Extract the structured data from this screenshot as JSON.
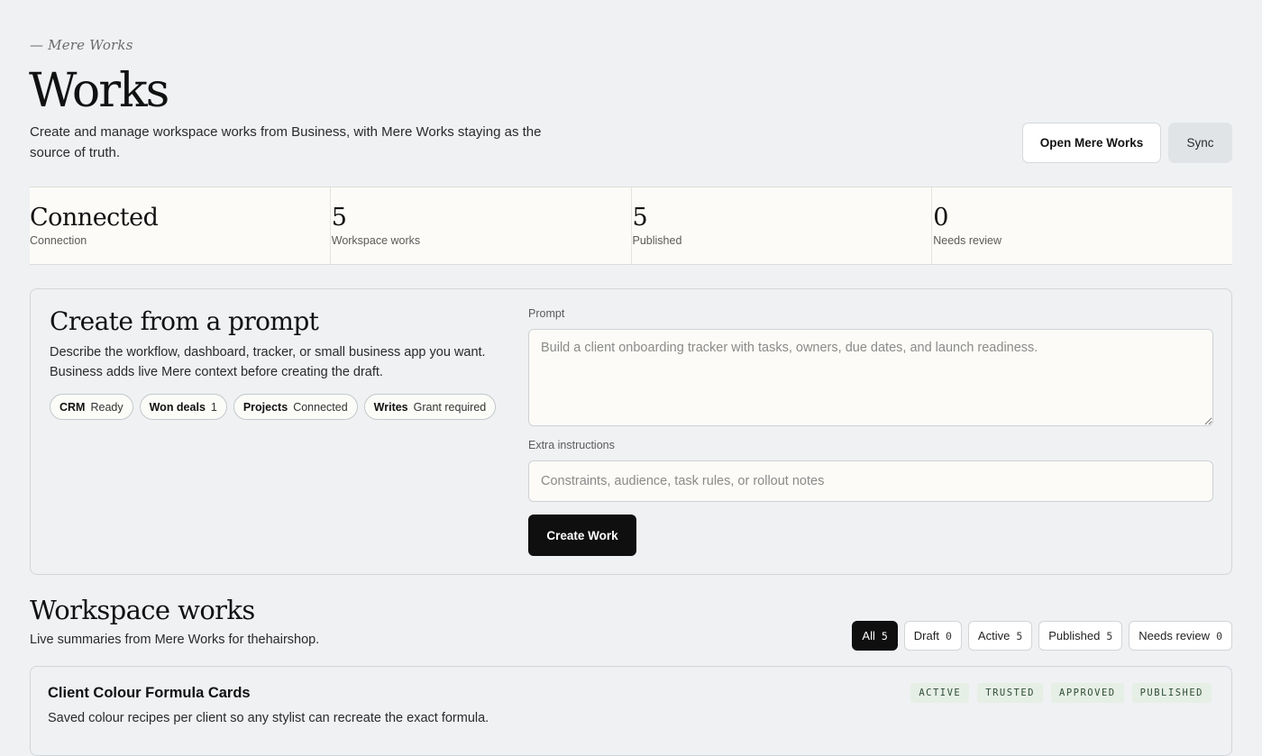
{
  "header": {
    "eyebrow": "— Mere Works",
    "title": "Works",
    "description": "Create and manage workspace works from Business, with Mere Works staying as the source of truth.",
    "open_button": "Open Mere Works",
    "sync_button": "Sync"
  },
  "stats": [
    {
      "value": "Connected",
      "label": "Connection"
    },
    {
      "value": "5",
      "label": "Workspace works"
    },
    {
      "value": "5",
      "label": "Published"
    },
    {
      "value": "0",
      "label": "Needs review"
    }
  ],
  "create": {
    "title": "Create from a prompt",
    "description": "Describe the workflow, dashboard, tracker, or small business app you want. Business adds live Mere context before creating the draft.",
    "chips": [
      {
        "name": "CRM",
        "status": "Ready"
      },
      {
        "name": "Won deals",
        "status": "1"
      },
      {
        "name": "Projects",
        "status": "Connected"
      },
      {
        "name": "Writes",
        "status": "Grant required"
      }
    ],
    "prompt_label": "Prompt",
    "prompt_placeholder": "Build a client onboarding tracker with tasks, owners, due dates, and launch readiness.",
    "extra_label": "Extra instructions",
    "extra_placeholder": "Constraints, audience, task rules, or rollout notes",
    "create_button": "Create Work"
  },
  "works": {
    "title": "Workspace works",
    "description": "Live summaries from Mere Works for thehairshop.",
    "filters": [
      {
        "label": "All",
        "count": "5",
        "active": true
      },
      {
        "label": "Draft",
        "count": "0",
        "active": false
      },
      {
        "label": "Active",
        "count": "5",
        "active": false
      },
      {
        "label": "Published",
        "count": "5",
        "active": false
      },
      {
        "label": "Needs review",
        "count": "0",
        "active": false
      }
    ],
    "items": [
      {
        "name": "Client Colour Formula Cards",
        "description": "Saved colour recipes per client so any stylist can recreate the exact formula.",
        "badges": [
          "ACTIVE",
          "TRUSTED",
          "APPROVED",
          "PUBLISHED"
        ]
      }
    ]
  }
}
